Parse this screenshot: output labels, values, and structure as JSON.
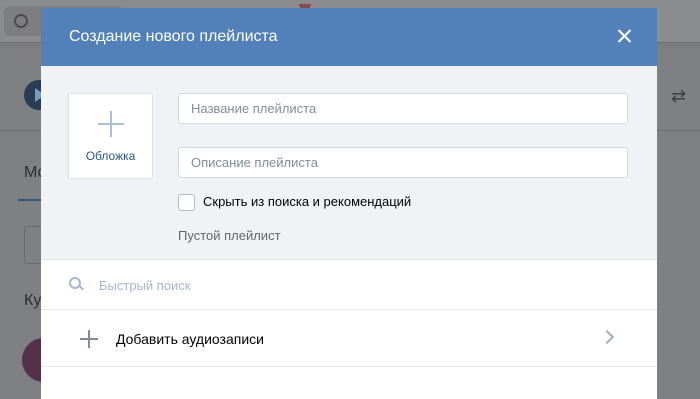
{
  "background": {
    "tab_label": "Мо",
    "heading_label": "Ку",
    "icons": [
      "search-icon",
      "play-icon",
      "shuffle-icon"
    ]
  },
  "modal": {
    "title": "Создание нового плейлиста",
    "close_icon": "close-icon",
    "cover": {
      "icon": "plus-icon",
      "label": "Обложка"
    },
    "name_field": {
      "placeholder": "Название плейлиста",
      "value": ""
    },
    "description_field": {
      "placeholder": "Описание плейлиста",
      "value": ""
    },
    "hide_checkbox": {
      "label": "Скрыть из поиска и рекомендаций",
      "checked": false
    },
    "empty_text": "Пустой плейлист",
    "search": {
      "icon": "search-icon",
      "placeholder": "Быстрый поиск"
    },
    "add_audio": {
      "icon": "plus-icon",
      "label": "Добавить аудиозаписи",
      "chevron": "chevron-right-icon"
    }
  },
  "colors": {
    "header": "#5181b8",
    "form_bg": "#f0f2f5",
    "link": "#2a5885",
    "search_placeholder": "#a6b7cd"
  }
}
